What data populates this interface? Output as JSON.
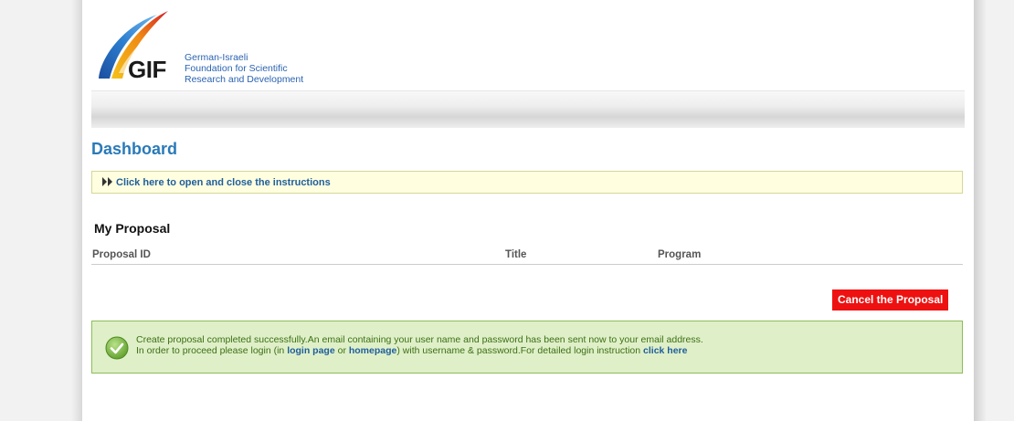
{
  "logo": {
    "mark": "GIF",
    "lines": [
      "German-Israeli",
      "Foundation for Scientific",
      "Research and Development"
    ]
  },
  "page": {
    "title": "Dashboard"
  },
  "instructions": {
    "label": "Click here to open and close the instructions"
  },
  "proposals": {
    "title": "My Proposal",
    "columns": [
      "Proposal ID",
      "Title",
      "Program"
    ]
  },
  "cancel_button": {
    "label": "Cancel the Proposal"
  },
  "success": {
    "line1": "Create proposal completed successfully.An email containing your user name and password has been sent now to your email address.",
    "line2_part1": "In order to proceed please login (in ",
    "login_link": "login page",
    "line2_part2": " or ",
    "homepage_link": "homepage",
    "line2_part3": ") with username & password.For detailed login instruction ",
    "click_here_link": "click here"
  },
  "colors": {
    "accent": "#2a7ab8",
    "cancel": "#ee1111",
    "success_bg": "#dff0c8",
    "success_text": "#3d6e16",
    "instructions_bg": "#ffffe0"
  },
  "icons": [
    "double-arrow-right-icon",
    "success-check-icon",
    "gif-swoosh-logo"
  ]
}
